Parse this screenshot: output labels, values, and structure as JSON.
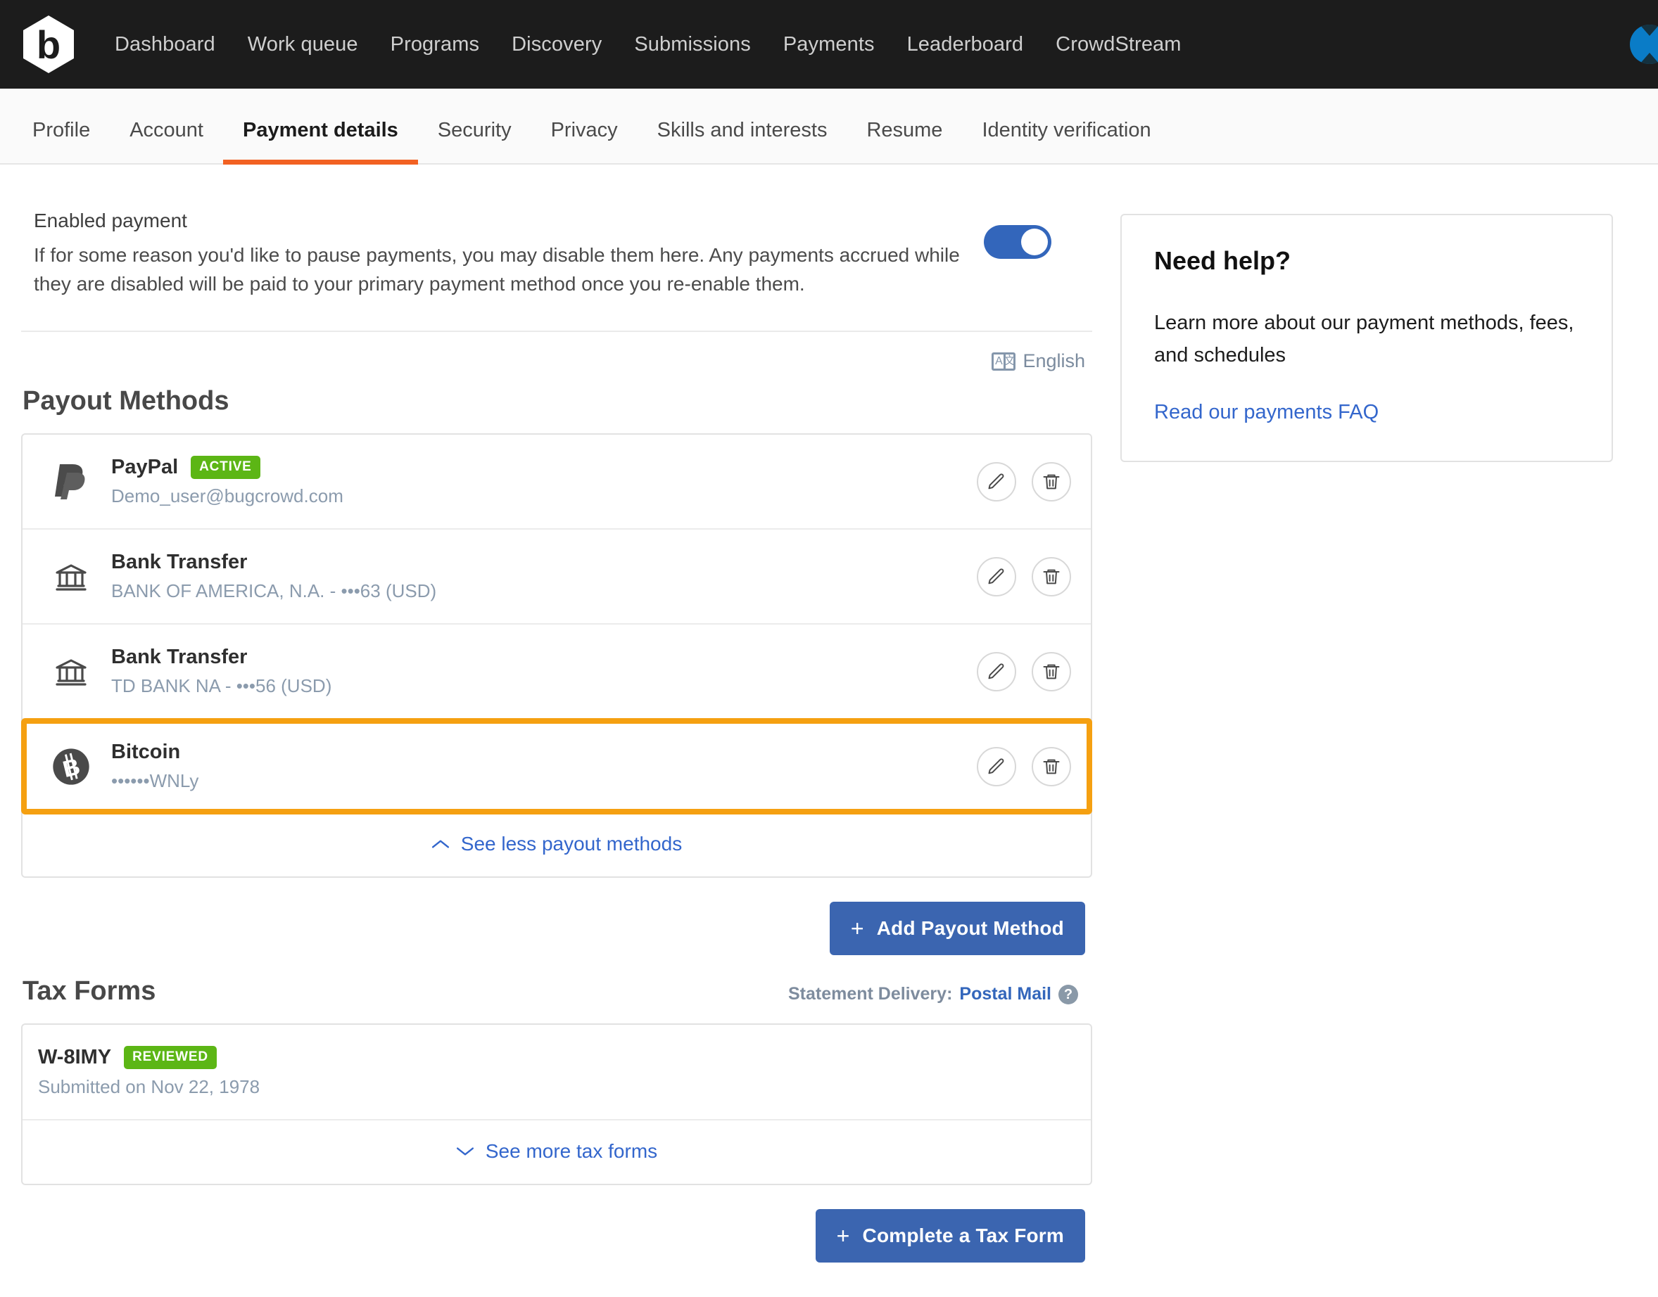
{
  "topnav": {
    "logo": "bugcrowd-logo",
    "links": [
      "Dashboard",
      "Work queue",
      "Programs",
      "Discovery",
      "Submissions",
      "Payments",
      "Leaderboard",
      "CrowdStream"
    ],
    "avatar": "user-avatar",
    "background_color": "#1c1c1c"
  },
  "subnav": {
    "tabs": [
      "Profile",
      "Account",
      "Payment details",
      "Security",
      "Privacy",
      "Skills and interests",
      "Resume",
      "Identity verification"
    ],
    "active_tab": "Payment details",
    "active_underline_color": "#f26122"
  },
  "enabled_payment": {
    "title": "Enabled payment",
    "description": "If for some reason you'd like to pause payments, you may disable them here. Any payments accrued while they are disabled will be paid to your primary payment method once you re-enable them.",
    "toggle_state": "on",
    "toggle_color": "#3366bb"
  },
  "language": {
    "icon": "translate-icon",
    "icon_left": "A",
    "icon_right": "文",
    "label": "English"
  },
  "payout": {
    "heading": "Payout Methods",
    "methods": [
      {
        "icon": "paypal-icon",
        "name": "PayPal",
        "badge": "ACTIVE",
        "badge_color": "#5cb615",
        "detail": "Demo_user@bugcrowd.com",
        "highlighted": false
      },
      {
        "icon": "bank-icon",
        "name": "Bank Transfer",
        "badge": "",
        "detail": "BANK OF AMERICA, N.A. - •••63 (USD)",
        "highlighted": false
      },
      {
        "icon": "bank-icon",
        "name": "Bank Transfer",
        "badge": "",
        "detail": "TD BANK NA - •••56 (USD)",
        "highlighted": false
      },
      {
        "icon": "bitcoin-icon",
        "name": "Bitcoin",
        "badge": "",
        "detail": "••••••WNLy",
        "highlighted": true,
        "highlight_color": "#f5a011"
      }
    ],
    "see_toggle_label": "See less payout methods",
    "see_toggle_icon": "chevron-up-icon",
    "add_button_label": "Add Payout Method",
    "add_button_plus": "+"
  },
  "tax": {
    "heading": "Tax Forms",
    "delivery_label": "Statement Delivery:",
    "delivery_value": "Postal Mail",
    "help_icon": "question-mark-icon",
    "forms": [
      {
        "name": "W-8IMY",
        "badge": "REVIEWED",
        "badge_color": "#5cb615",
        "submitted": "Submitted on Nov 22, 1978"
      }
    ],
    "see_toggle_label": "See more tax forms",
    "see_toggle_icon": "chevron-down-icon",
    "complete_button_label": "Complete a Tax Form",
    "complete_button_plus": "+"
  },
  "help_panel": {
    "title": "Need help?",
    "text": "Learn more about our payment methods, fees, and schedules",
    "link": "Read our payments FAQ",
    "link_color": "#3366cc"
  }
}
